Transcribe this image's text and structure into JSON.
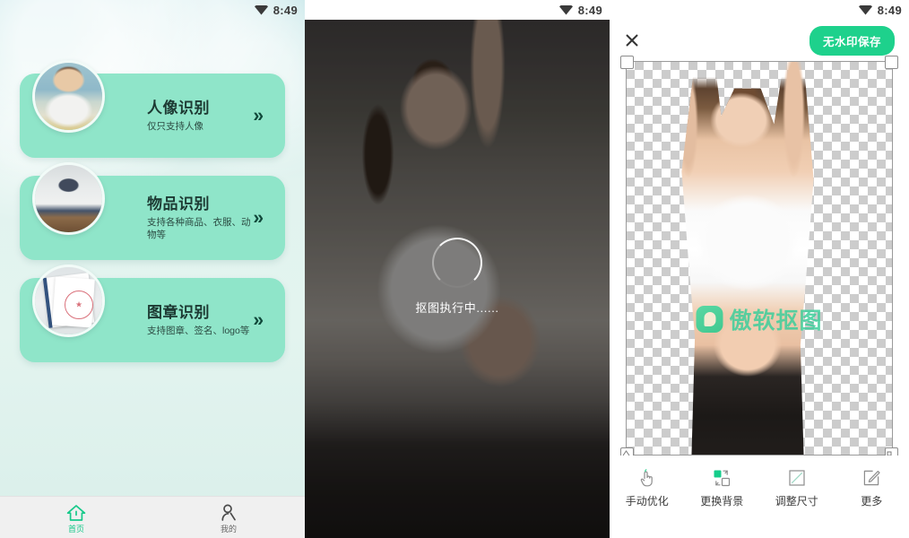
{
  "status_bar": {
    "time": "8:49",
    "wifi_icon": "wifi-icon"
  },
  "home": {
    "cards": [
      {
        "title": "人像识别",
        "subtitle": "仅只支持人像",
        "arrow": "»",
        "thumb_icon": "portrait-thumbnail"
      },
      {
        "title": "物品识别",
        "subtitle": "支持各种商品、衣服、动物等",
        "arrow": "»",
        "thumb_icon": "handbag-thumbnail"
      },
      {
        "title": "图章识别",
        "subtitle": "支持图章、签名、logo等",
        "arrow": "»",
        "thumb_icon": "stamp-thumbnail"
      }
    ],
    "tabs": [
      {
        "label": "首页",
        "icon": "home-icon",
        "active": true
      },
      {
        "label": "我的",
        "icon": "person-icon",
        "active": false
      }
    ]
  },
  "processing": {
    "status_text": "抠图执行中......",
    "spinner_icon": "loading-spinner-icon"
  },
  "result": {
    "close_icon": "close-icon",
    "save_label": "无水印保存",
    "watermark_text": "傲软抠图",
    "watermark_logo_icon": "apowersoft-logo-icon",
    "tools": [
      {
        "label": "手动优化",
        "icon": "hand-pointer-icon"
      },
      {
        "label": "更换背景",
        "icon": "replace-background-icon"
      },
      {
        "label": "调整尺寸",
        "icon": "resize-icon"
      },
      {
        "label": "更多",
        "icon": "edit-pencil-icon"
      }
    ]
  },
  "colors": {
    "card_green": "#8fe5c9",
    "accent_green": "#1ed18c",
    "watermark_green": "#3ece9b",
    "tab_active": "#17c98a",
    "bg_mint": "#e3f4ef"
  }
}
